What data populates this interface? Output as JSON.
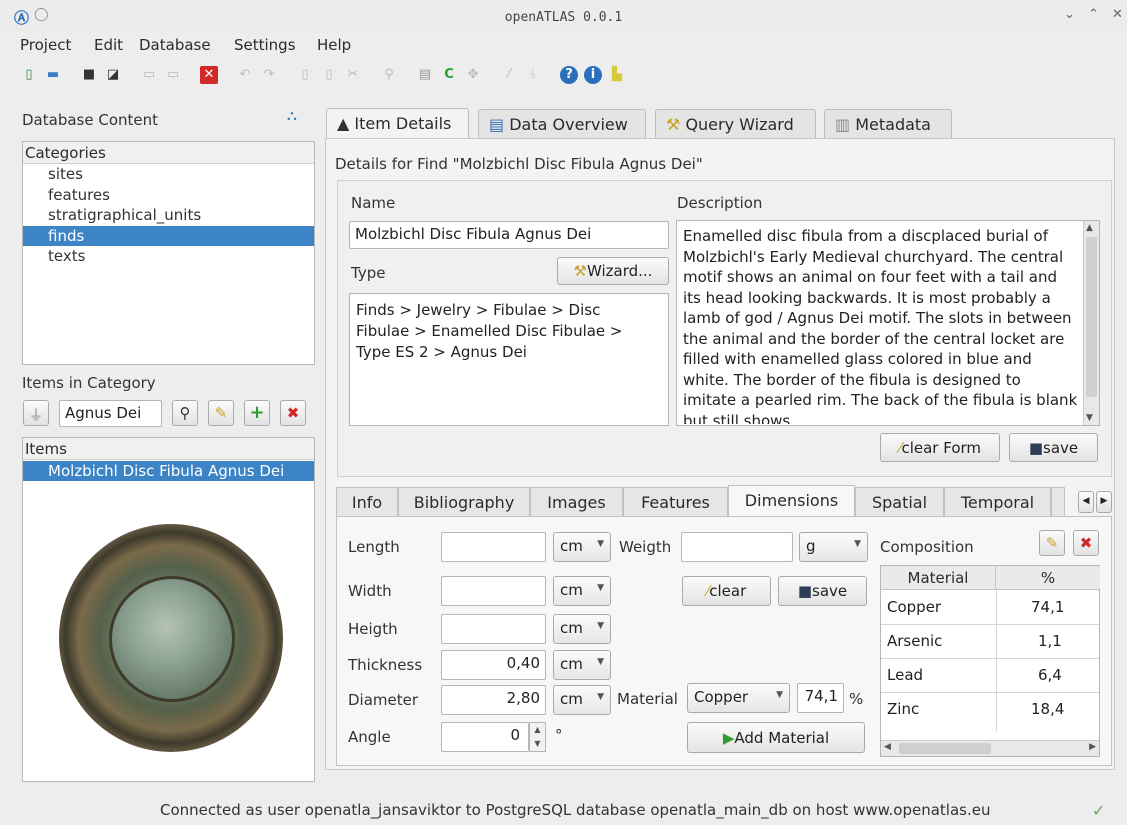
{
  "window": {
    "title": "openATLAS 0.0.1"
  },
  "menu": [
    "Project",
    "Edit",
    "Database",
    "Settings",
    "Help"
  ],
  "toolbar_icons": [
    "new-icon",
    "save-db-icon",
    "save-icon",
    "save-as-icon",
    "copy-icon",
    "paste-icon",
    "close-icon",
    "undo-icon",
    "redo-icon",
    "page-icon",
    "page2-icon",
    "cut-icon",
    "find-icon",
    "database-icon",
    "refresh-icon",
    "connect-icon",
    "tool-icon",
    "pin-icon",
    "help-icon",
    "info-icon",
    "export-icon"
  ],
  "left": {
    "db_content_label": "Database Content",
    "categories_header": "Categories",
    "categories": [
      "sites",
      "features",
      "stratigraphical_units",
      "finds",
      "texts"
    ],
    "selected_category": "finds",
    "items_in_category_label": "Items in Category",
    "filter_value": "Agnus Dei",
    "items_header": "Items",
    "selected_item": "Molzbichl Disc Fibula Agnus Dei"
  },
  "tabs": [
    "Item Details",
    "Data Overview",
    "Query Wizard",
    "Metadata"
  ],
  "details": {
    "heading": "Details for Find \"Molzbichl Disc Fibula Agnus Dei\"",
    "name_label": "Name",
    "name_value": "Molzbichl Disc Fibula Agnus Dei",
    "type_label": "Type",
    "wizard_button": "Wizard...",
    "type_value": "Finds > Jewelry > Fibulae > Disc Fibulae > Enamelled Disc Fibulae > Type ES 2 > Agnus Dei",
    "description_label": "Description",
    "description_value": "Enamelled disc fibula from a discplaced burial of Molzbichl's Early Medieval churchyard. The central motif shows an animal on four feet with a tail and its head looking backwards. It is most probably a lamb of god / Agnus Dei motif. The slots in between the animal and the border of the central locket are filled with enamelled glass colored in blue and white. The border of the fibula is designed to imitate a pearled rim. The back of the fibula is blank but still shows",
    "clear_form_button": "clear Form",
    "save_button": "save"
  },
  "subtabs": [
    "Info",
    "Bibliography",
    "Images",
    "Features",
    "Dimensions",
    "Spatial",
    "Temporal"
  ],
  "dimensions": {
    "length_label": "Length",
    "length_value": "",
    "length_unit": "cm",
    "weigth_label": "Weigth",
    "weigth_value": "",
    "weigth_unit": "g",
    "width_label": "Width",
    "width_value": "",
    "width_unit": "cm",
    "heigth_label": "Heigth",
    "heigth_value": "",
    "heigth_unit": "cm",
    "thickness_label": "Thickness",
    "thickness_value": "0,40",
    "thickness_unit": "cm",
    "diameter_label": "Diameter",
    "diameter_value": "2,80",
    "diameter_unit": "cm",
    "angle_label": "Angle",
    "angle_value": "0",
    "angle_unit": "°",
    "clear_button": "clear",
    "save_button": "save",
    "material_label": "Material",
    "material_value": "Copper",
    "material_percent": "74,1",
    "percent_sign": "%",
    "add_material_button": "Add Material"
  },
  "composition": {
    "label": "Composition",
    "headers": [
      "Material",
      "%"
    ],
    "rows": [
      {
        "material": "Copper",
        "percent": "74,1"
      },
      {
        "material": "Arsenic",
        "percent": "1,1"
      },
      {
        "material": "Lead",
        "percent": "6,4"
      },
      {
        "material": "Zinc",
        "percent": "18,4"
      }
    ]
  },
  "status": {
    "text": "Connected as user openatla_jansaviktor to PostgreSQL database openatla_main_db on host www.openatlas.eu"
  },
  "colors": {
    "selection": "#3d84c6",
    "window_bg": "#ededed",
    "accent_green": "#2e9b2e",
    "accent_red": "#d02a2a"
  }
}
